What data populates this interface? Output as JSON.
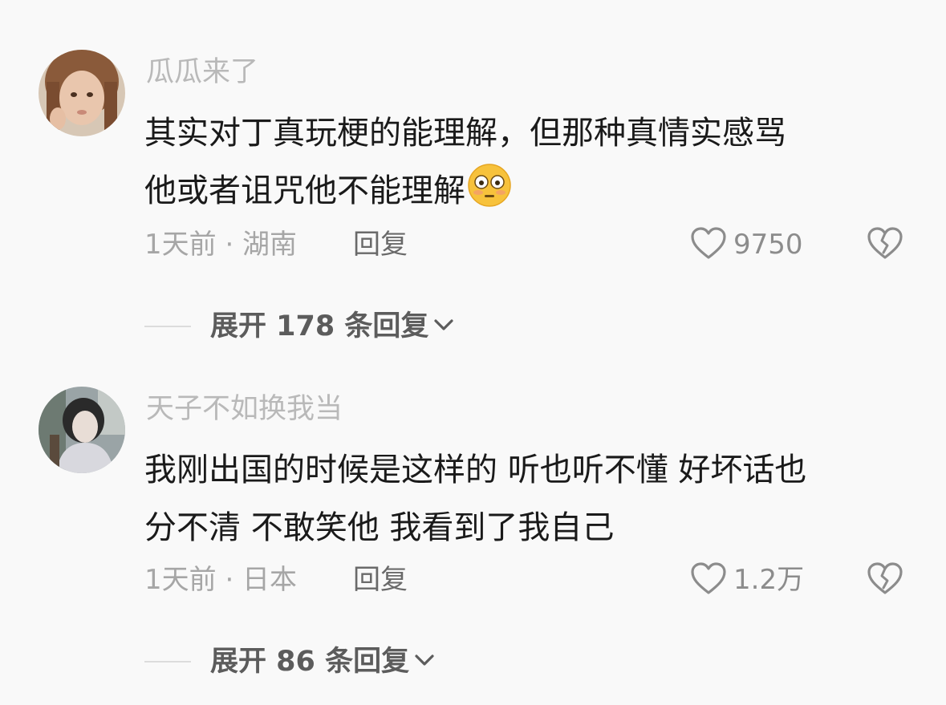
{
  "comments": [
    {
      "username": "瓜瓜来了",
      "avatar_icon": "girl-portrait-avatar",
      "text_lines": [
        "其实对丁真玩梗的能理解，但那种真情实感骂",
        "他或者诅咒他不能理解"
      ],
      "emoji": "flushed-face-emoji",
      "meta": "1天前 · 湖南",
      "reply_label": "回复",
      "likes": "9750",
      "expand_label": "展开 178 条回复"
    },
    {
      "username": "天子不如换我当",
      "avatar_icon": "person-portrait-avatar",
      "text_lines": [
        "我刚出国的时候是这样的 听也听不懂 好坏话也",
        "分不清 不敢笑他 我看到了我自己"
      ],
      "meta": "1天前 · 日本",
      "reply_label": "回复",
      "likes": "1.2万",
      "expand_label": "展开 86 条回复"
    }
  ],
  "colors": {
    "background": "#f9f9f9",
    "username": "#b9b9b9",
    "text": "#1a1a1a",
    "meta": "#a6a6a6",
    "icon": "#8c8c8c"
  }
}
